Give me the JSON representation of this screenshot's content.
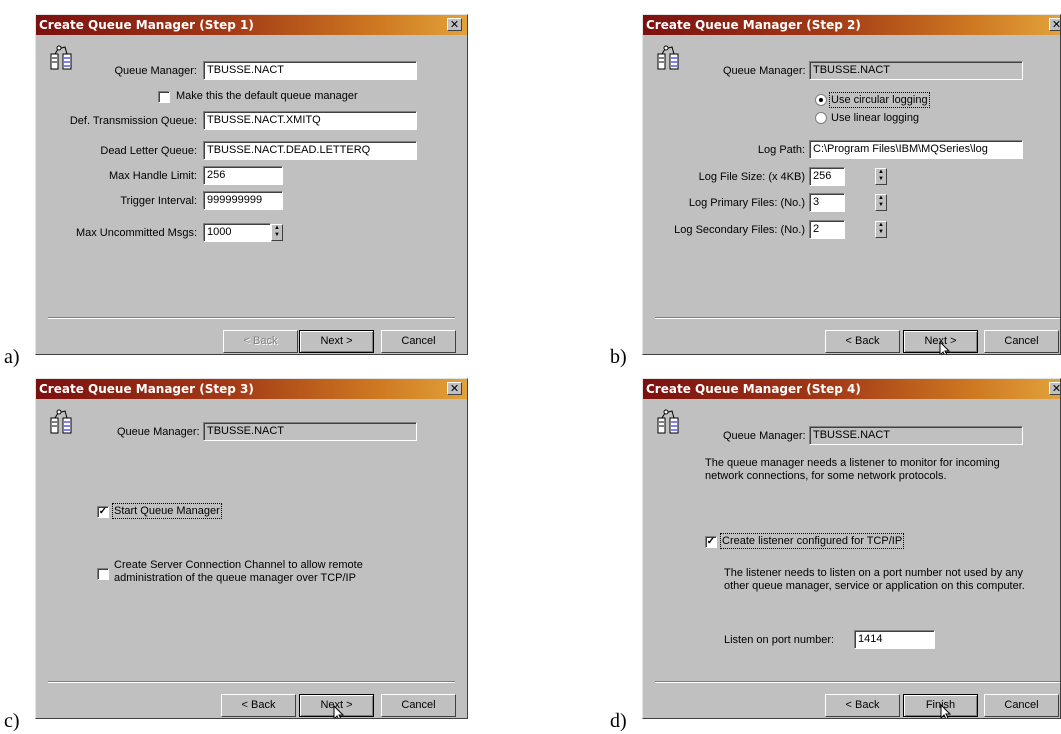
{
  "panel_labels": [
    "a)",
    "b)",
    "c)",
    "d)"
  ],
  "close_glyph": "✕",
  "buttons": {
    "back": "< Back",
    "next": "Next >",
    "finish": "Finish",
    "cancel": "Cancel"
  },
  "step1": {
    "title": "Create Queue Manager (Step 1)",
    "queue_manager_label": "Queue Manager:",
    "queue_manager_value": "TBUSSE.NACT",
    "default_qm_label": "Make this the default queue manager",
    "default_qm_checked": false,
    "def_xmit_label": "Def. Transmission Queue:",
    "def_xmit_value": "TBUSSE.NACT.XMITQ",
    "dlq_label": "Dead Letter Queue:",
    "dlq_value": "TBUSSE.NACT.DEAD.LETTERQ",
    "max_handle_label": "Max Handle Limit:",
    "max_handle_value": "256",
    "trigger_label": "Trigger Interval:",
    "trigger_value": "999999999",
    "max_uncommitted_label": "Max Uncommitted Msgs:",
    "max_uncommitted_value": "1000"
  },
  "step2": {
    "title": "Create Queue Manager (Step 2)",
    "queue_manager_label": "Queue Manager:",
    "queue_manager_value": "TBUSSE.NACT",
    "circular_label": "Use circular logging",
    "linear_label": "Use linear logging",
    "selected_logging": "circular",
    "log_path_label": "Log Path:",
    "log_path_value": "C:\\Program Files\\IBM\\MQSeries\\log",
    "log_file_size_label": "Log File Size: (x 4KB)",
    "log_file_size_value": "256",
    "log_primary_label": "Log Primary Files: (No.)",
    "log_primary_value": "3",
    "log_secondary_label": "Log Secondary Files: (No.)",
    "log_secondary_value": "2"
  },
  "step3": {
    "title": "Create Queue Manager (Step 3)",
    "queue_manager_label": "Queue Manager:",
    "queue_manager_value": "TBUSSE.NACT",
    "start_qm_label": "Start Queue Manager",
    "start_qm_checked": true,
    "svrconn_line1": "Create Server Connection Channel to allow remote",
    "svrconn_line2": "administration of the queue manager over TCP/IP",
    "svrconn_checked": false
  },
  "step4": {
    "title": "Create Queue Manager (Step 4)",
    "queue_manager_label": "Queue Manager:",
    "queue_manager_value": "TBUSSE.NACT",
    "info_line1": "The queue manager needs a listener to monitor for incoming",
    "info_line2": "network connections, for some network protocols.",
    "listener_label": "Create listener configured for TCP/IP",
    "listener_checked": true,
    "port_info_line1": "The listener needs to listen on a port number not used by any",
    "port_info_line2": "other queue manager, service or application on this computer.",
    "port_label": "Listen on port number:",
    "port_value": "1414"
  },
  "colors": {
    "dialog_bg": "#c0c0c0",
    "title_start": "#7b1010",
    "title_end": "#e2a23a"
  }
}
